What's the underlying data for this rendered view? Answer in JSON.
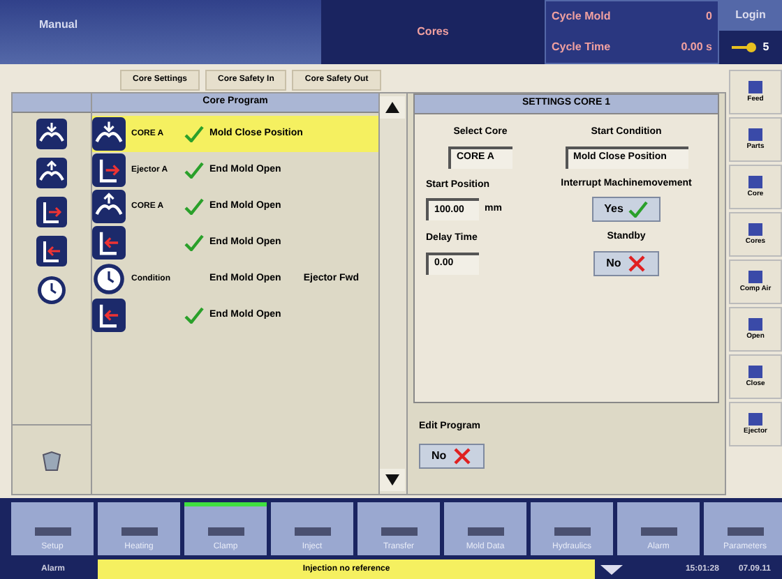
{
  "header": {
    "mode": "Manual",
    "title": "Cores",
    "cycle_mold_label": "Cycle Mold",
    "cycle_mold_value": "0",
    "cycle_time_label": "Cycle Time",
    "cycle_time_value": "0.00 s",
    "login": "Login",
    "user_level": "5"
  },
  "tabs": [
    "Core Settings",
    "Core Safety In",
    "Core Safety Out"
  ],
  "left_icons": [
    {
      "kind": "core_in"
    },
    {
      "kind": "core_out"
    },
    {
      "kind": "ejector_fwd"
    },
    {
      "kind": "ejector_back"
    },
    {
      "kind": "timer"
    }
  ],
  "program": {
    "title": "Core Program",
    "rows": [
      {
        "kind": "core_in",
        "name": "CORE A",
        "checked": true,
        "condition": "Mold Close Position",
        "selected": true
      },
      {
        "kind": "ejector_fwd",
        "name": "Ejector A",
        "checked": true,
        "condition": "End Mold Open",
        "selected": false
      },
      {
        "kind": "core_out",
        "name": "CORE A",
        "checked": true,
        "condition": "End Mold Open",
        "selected": false
      },
      {
        "kind": "ejector_back",
        "name": "",
        "checked": true,
        "condition": "End Mold Open",
        "selected": false
      },
      {
        "kind": "timer",
        "name": "Condition",
        "checked": false,
        "condition": "End Mold Open",
        "extra": "Ejector Fwd",
        "selected": false
      },
      {
        "kind": "ejector_back",
        "name": "",
        "checked": true,
        "condition": "End Mold Open",
        "selected": false
      }
    ]
  },
  "settings": {
    "title": "SETTINGS CORE 1",
    "select_core_label": "Select Core",
    "select_core_value": "CORE A",
    "start_condition_label": "Start Condition",
    "start_condition_value": "Mold Close Position",
    "start_position_label": "Start Position",
    "start_position_value": "100.00",
    "start_position_unit": "mm",
    "interrupt_label": "Interrupt Machinemovement",
    "interrupt_button": {
      "label": "Yes",
      "checked": true
    },
    "delay_label": "Delay Time",
    "delay_value": "0.00",
    "standby_label": "Standby",
    "standby_button": {
      "label": "No",
      "checked": false
    }
  },
  "edit_program": {
    "label": "Edit Program",
    "button": {
      "label": "No",
      "checked": false
    }
  },
  "sidebar": [
    "Feed",
    "Parts",
    "Core",
    "Cores",
    "Comp Air",
    "Open",
    "Close",
    "Ejector"
  ],
  "toolbar": [
    {
      "label": "Setup",
      "selected": false
    },
    {
      "label": "Heating",
      "selected": false
    },
    {
      "label": "Clamp",
      "selected": true
    },
    {
      "label": "Inject",
      "selected": false
    },
    {
      "label": "Transfer",
      "selected": false
    },
    {
      "label": "Mold Data",
      "selected": false
    },
    {
      "label": "Hydraulics",
      "selected": false
    },
    {
      "label": "Alarm",
      "selected": false
    },
    {
      "label": "Parameters",
      "selected": false
    }
  ],
  "status": {
    "alarm": "Alarm",
    "message": "Injection no reference",
    "time": "15:01:28",
    "date": "07.09.11"
  }
}
